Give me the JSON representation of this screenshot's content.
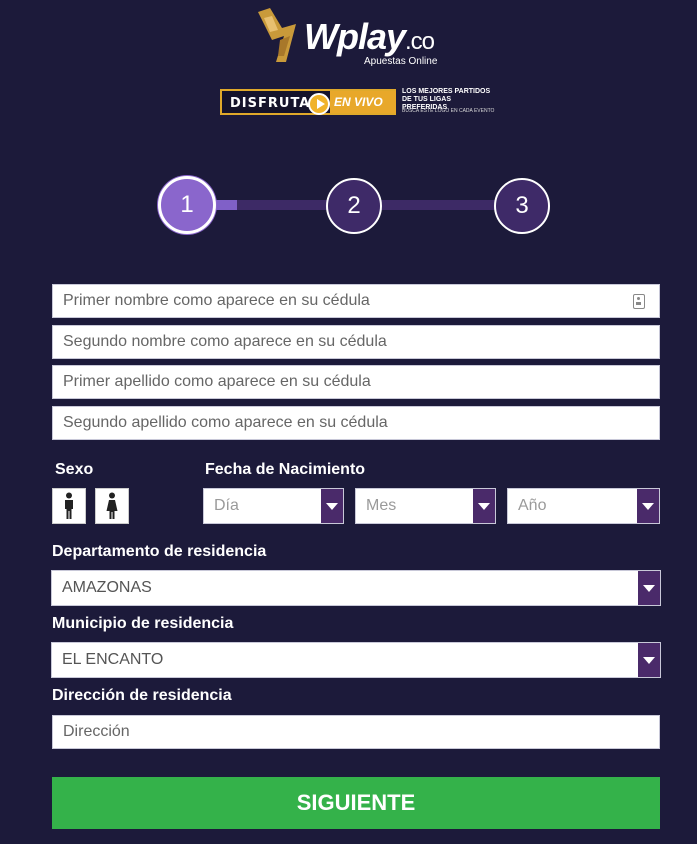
{
  "brand": {
    "logo_main": "Wplay",
    "logo_suffix": ".co",
    "logo_tagline": "Apuestas Online",
    "accent": "#e0a92a"
  },
  "banner": {
    "left_text": "DISFRUTA",
    "right_text": "EN VIVO",
    "copy": "LOS MEJORES PARTIDOS DE TUS LIGAS PREFERIDAS",
    "small_print": "BUSCA ESTE LOGO EN CADA EVENTO"
  },
  "stepper": {
    "steps": [
      "1",
      "2",
      "3"
    ],
    "current_step": 1,
    "active_color": "#8a66cc",
    "inactive_color": "#3e2a68"
  },
  "form": {
    "first_name_placeholder": "Primer nombre como aparece en su cédula",
    "second_name_placeholder": "Segundo nombre como aparece en su cédula",
    "first_surname_placeholder": "Primer apellido como aparece en su cédula",
    "second_surname_placeholder": "Segundo apellido como aparece en su cédula",
    "sex_label": "Sexo",
    "birth_label": "Fecha de Nacimiento",
    "day_placeholder": "Día",
    "month_placeholder": "Mes",
    "year_placeholder": "Año",
    "department_label": "Departamento de residencia",
    "department_value": "AMAZONAS",
    "municipality_label": "Municipio de residencia",
    "municipality_value": "EL ENCANTO",
    "address_label": "Dirección de residencia",
    "address_placeholder": "Dirección",
    "submit_label": "SIGUIENTE",
    "submit_color": "#34b24a"
  }
}
